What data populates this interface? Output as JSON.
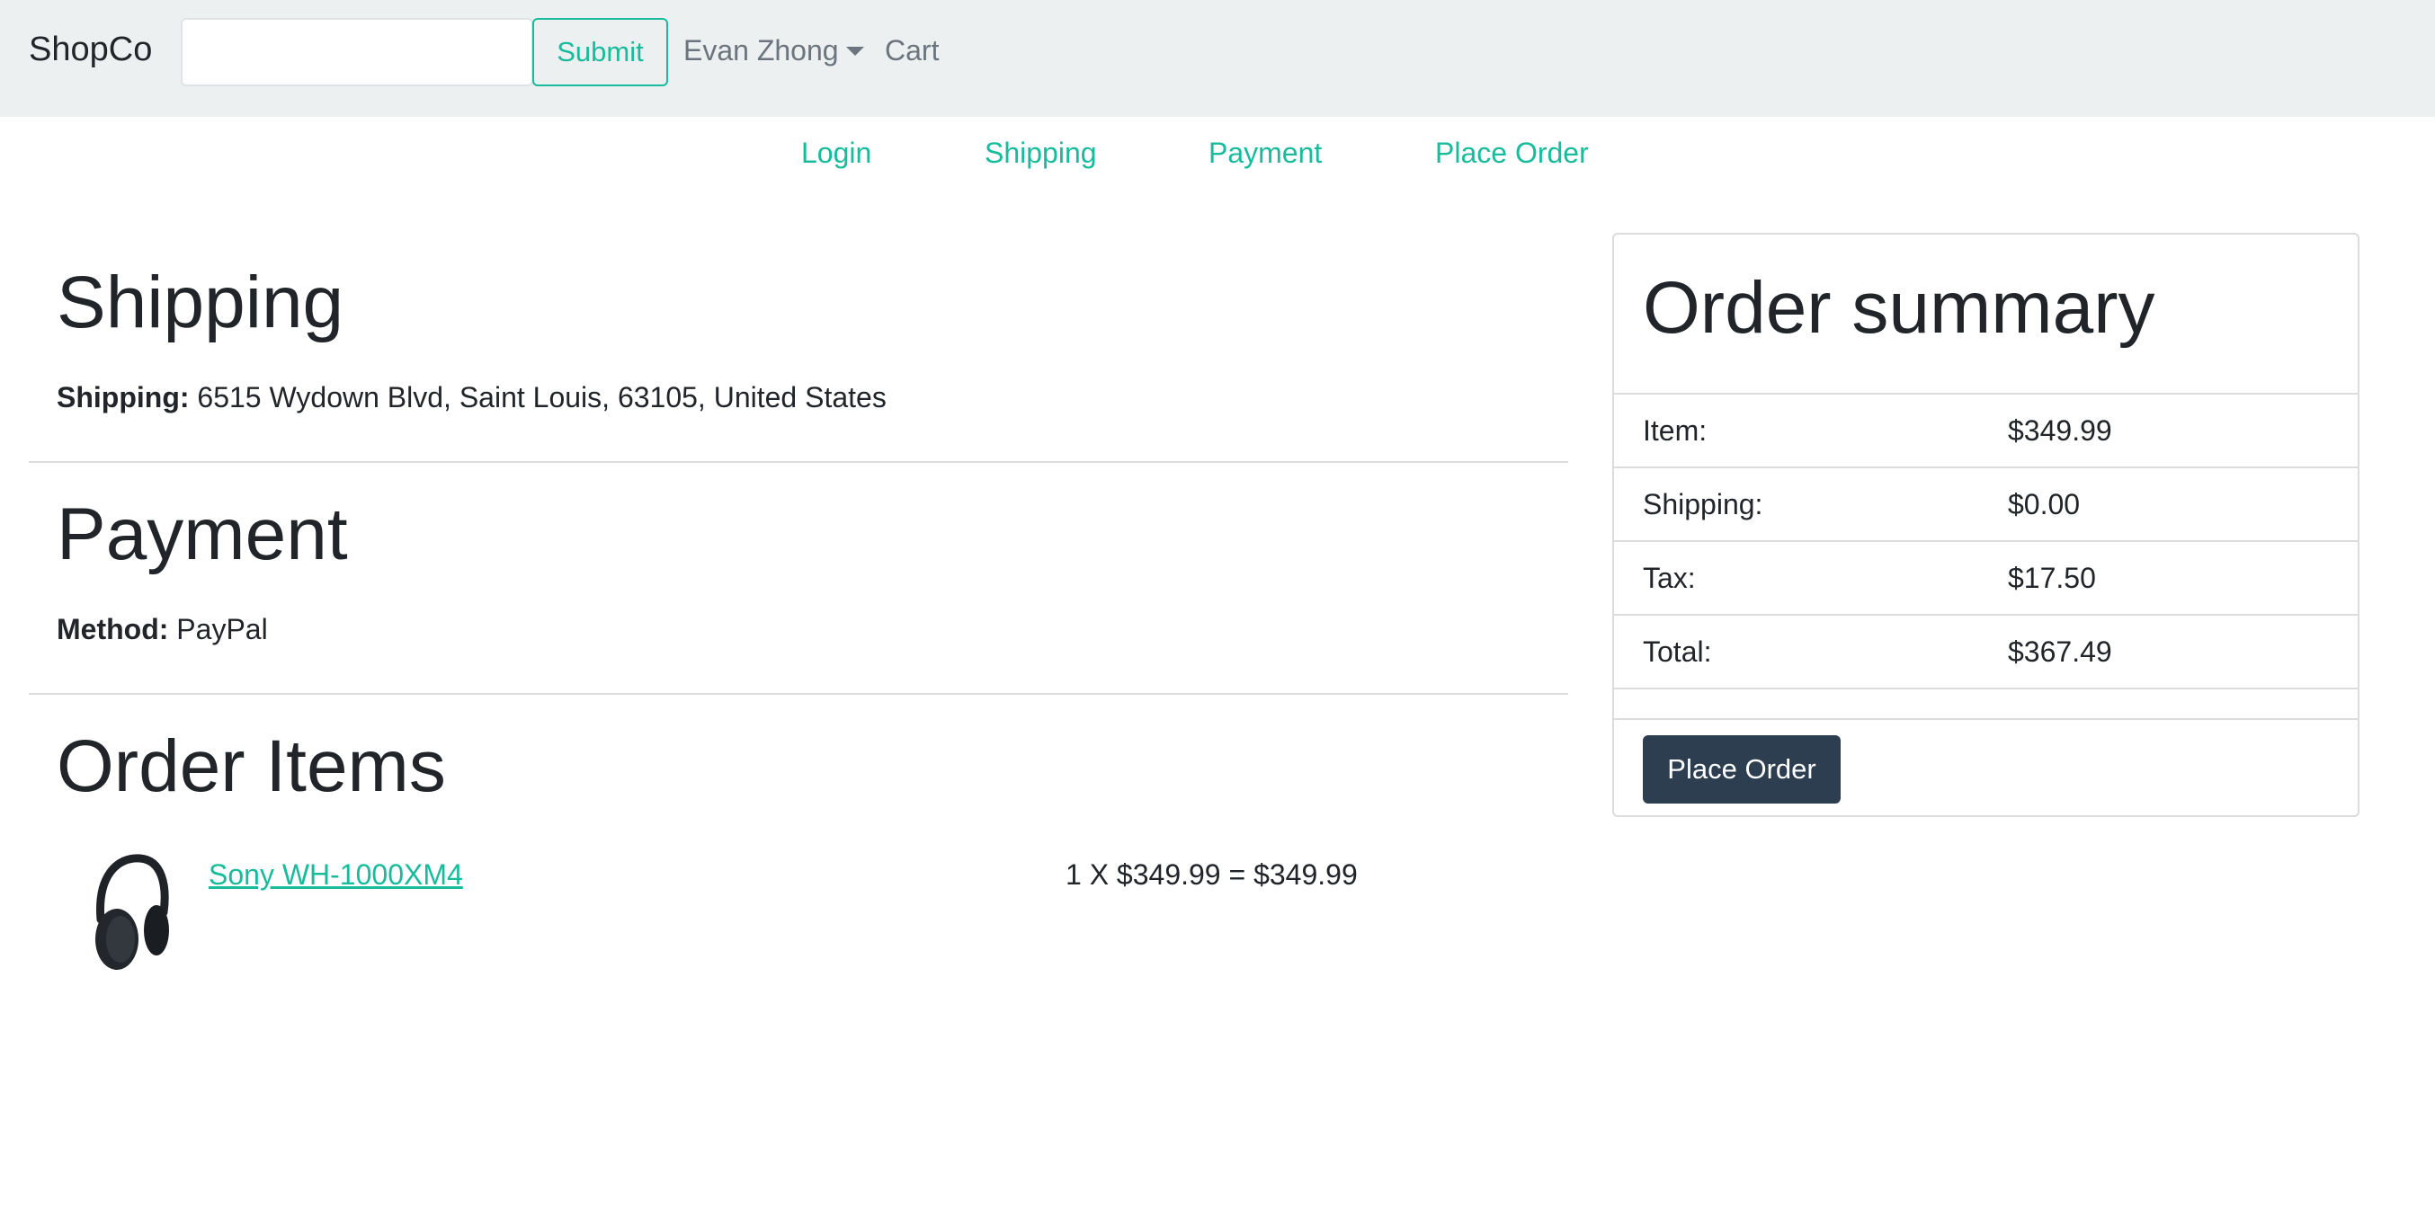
{
  "navbar": {
    "brand": "ShopCo",
    "search_value": "",
    "submit_label": "Submit",
    "user_name": "Evan Zhong",
    "cart_label": "Cart"
  },
  "steps": [
    "Login",
    "Shipping",
    "Payment",
    "Place Order"
  ],
  "shipping": {
    "title": "Shipping",
    "label": "Shipping:",
    "address": "6515 Wydown Blvd, Saint Louis, 63105, United States"
  },
  "payment": {
    "title": "Payment",
    "label": "Method:",
    "method": "PayPal"
  },
  "order_items": {
    "title": "Order Items",
    "items": [
      {
        "name": "Sony WH-1000XM4",
        "calc": "1 X $349.99 = $349.99",
        "image_icon": "headphones-icon"
      }
    ]
  },
  "summary": {
    "title": "Order summary",
    "rows": [
      {
        "label": "Item:",
        "value": "$349.99"
      },
      {
        "label": "Shipping:",
        "value": "$0.00"
      },
      {
        "label": "Tax:",
        "value": "$17.50"
      },
      {
        "label": "Total:",
        "value": "$367.49"
      }
    ],
    "button_label": "Place Order"
  },
  "colors": {
    "navbar_bg": "#ecf0f1",
    "accent": "#18bc9c",
    "primary_button": "#2c3e50"
  }
}
